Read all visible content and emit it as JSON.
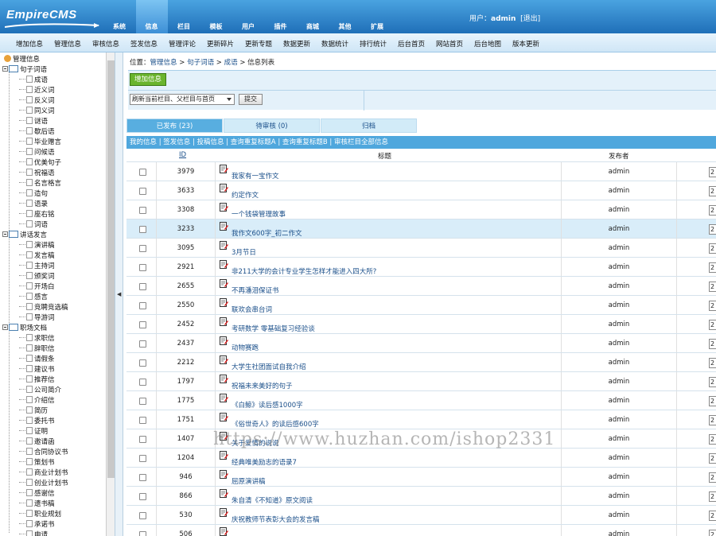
{
  "logo": {
    "text": "EmpireCMS"
  },
  "nav": [
    {
      "id": "system",
      "label": "系统",
      "icon": "globe-icon",
      "active": false
    },
    {
      "id": "info",
      "label": "信息",
      "icon": "document-edit-icon",
      "active": true
    },
    {
      "id": "column",
      "label": "栏目",
      "icon": "folder-icon",
      "active": false
    },
    {
      "id": "template",
      "label": "模板",
      "icon": "window-icon",
      "active": false
    },
    {
      "id": "user",
      "label": "用户",
      "icon": "user-icon",
      "active": false
    },
    {
      "id": "plugin",
      "label": "插件",
      "icon": "tools-icon",
      "active": false
    },
    {
      "id": "shop",
      "label": "商城",
      "icon": "card-icon",
      "active": false
    },
    {
      "id": "other",
      "label": "其他",
      "icon": "gear-icon",
      "active": false
    },
    {
      "id": "extend",
      "label": "扩展",
      "icon": "plus-circle-icon",
      "active": false
    }
  ],
  "userbar": {
    "prefix": "用户：",
    "name": "admin",
    "logout": "[退出]"
  },
  "submenu": [
    "增加信息",
    "管理信息",
    "审核信息",
    "签发信息",
    "管理评论",
    "更新碎片",
    "更新专题",
    "数据更新",
    "数据统计",
    "排行统计",
    "后台首页",
    "网站首页",
    "后台地图",
    "版本更新"
  ],
  "tree": {
    "root": "管理信息",
    "groups": [
      {
        "label": "句子词语",
        "items": [
          "成语",
          "近义词",
          "反义词",
          "同义词",
          "谜语",
          "歇后语",
          "毕业赠言",
          "问候语",
          "优美句子",
          "祝福语",
          "名言格言",
          "造句",
          "语录",
          "座右铭",
          "词语"
        ]
      },
      {
        "label": "讲话发言",
        "items": [
          "演讲稿",
          "发言稿",
          "主持词",
          "颁奖词",
          "开场白",
          "感言",
          "竞聘竞选稿",
          "导游词"
        ]
      },
      {
        "label": "职场文档",
        "items": [
          "求职信",
          "辞职信",
          "请假条",
          "建议书",
          "推荐信",
          "公司简介",
          "介绍信",
          "简历",
          "委托书",
          "证明",
          "邀请函",
          "合同协议书",
          "策划书",
          "商业计划书",
          "创业计划书",
          "感谢信",
          "遗书稿",
          "职业规划",
          "承诺书",
          "申请"
        ]
      }
    ]
  },
  "breadcrumb": {
    "prefix": "位置：",
    "items": [
      "管理信息",
      "句子词语",
      "成语",
      "信息列表"
    ],
    "sep": ">"
  },
  "toolbar": {
    "add_label": "增加信息",
    "select_value": "刷新当前栏目、父栏目与首页",
    "submit_label": "提交"
  },
  "tabs": [
    {
      "label": "已发布 (23)",
      "active": true
    },
    {
      "label": "待审核 (0)",
      "active": false
    },
    {
      "label": "归档",
      "active": false
    }
  ],
  "filters": "我的信息 | 签发信息 | 投稿信息 | 查询重复标题A | 查询重复标题B | 审核栏目全部信息",
  "table": {
    "headers": {
      "id": "ID",
      "title": "标题",
      "publisher": "发布者"
    },
    "rows": [
      {
        "id": "3979",
        "title": "我家有一宝作文",
        "publisher": "admin",
        "order": "2",
        "highlight": false
      },
      {
        "id": "3633",
        "title": "约定作文",
        "publisher": "admin",
        "order": "2",
        "highlight": false
      },
      {
        "id": "3308",
        "title": "一个钱袋管理故事",
        "publisher": "admin",
        "order": "2",
        "highlight": false
      },
      {
        "id": "3233",
        "title": "我作文600字_初二作文",
        "publisher": "admin",
        "order": "2",
        "highlight": true
      },
      {
        "id": "3095",
        "title": "3月节日",
        "publisher": "admin",
        "order": "2",
        "highlight": false
      },
      {
        "id": "2921",
        "title": "非211大学的会计专业学生怎样才能进入四大所?",
        "publisher": "admin",
        "order": "2",
        "highlight": false
      },
      {
        "id": "2655",
        "title": "不再潘泪保证书",
        "publisher": "admin",
        "order": "2",
        "highlight": false
      },
      {
        "id": "2550",
        "title": "联欢会串台词",
        "publisher": "admin",
        "order": "2",
        "highlight": false
      },
      {
        "id": "2452",
        "title": "考研数学 零基础复习经验谈",
        "publisher": "admin",
        "order": "2",
        "highlight": false
      },
      {
        "id": "2437",
        "title": "动物赛跑",
        "publisher": "admin",
        "order": "2",
        "highlight": false
      },
      {
        "id": "2212",
        "title": "大学生社团面试自我介绍",
        "publisher": "admin",
        "order": "2",
        "highlight": false
      },
      {
        "id": "1797",
        "title": "祝福未来美好的句子",
        "publisher": "admin",
        "order": "2",
        "highlight": false
      },
      {
        "id": "1775",
        "title": "《白鲸》读后感1000字",
        "publisher": "admin",
        "order": "2",
        "highlight": false
      },
      {
        "id": "1751",
        "title": "《俗世奇人》的读后感600字",
        "publisher": "admin",
        "order": "2",
        "highlight": false
      },
      {
        "id": "1407",
        "title": "关于爱情的说说",
        "publisher": "admin",
        "order": "2",
        "highlight": false
      },
      {
        "id": "1204",
        "title": "经典唯美励志的语录7",
        "publisher": "admin",
        "order": "2",
        "highlight": false
      },
      {
        "id": "946",
        "title": "屈原演讲稿",
        "publisher": "admin",
        "order": "2",
        "highlight": false
      },
      {
        "id": "866",
        "title": "朱自清《不知道》原文阅读",
        "publisher": "admin",
        "order": "2",
        "highlight": false
      },
      {
        "id": "530",
        "title": "庆祝教师节表彰大会的发言稿",
        "publisher": "admin",
        "order": "2",
        "highlight": false
      },
      {
        "id": "506",
        "title": "",
        "publisher": "admin",
        "order": "2",
        "highlight": false
      }
    ]
  },
  "watermark": "https://www.huzhan.com/ishop2331"
}
